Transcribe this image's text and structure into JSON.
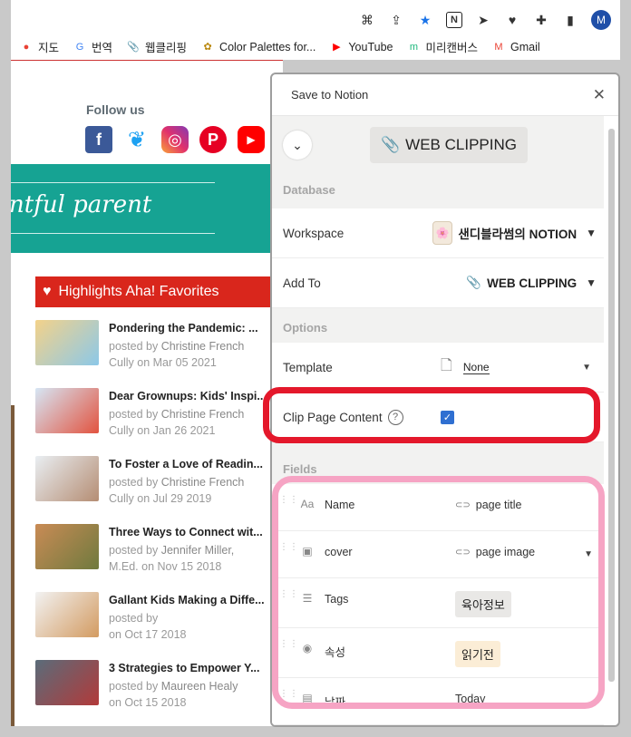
{
  "browser": {
    "bookmarks": [
      {
        "label": "지도",
        "icon": "maps-pin-icon",
        "color": "#e94235"
      },
      {
        "label": "번역",
        "icon": "translate-icon",
        "color": "#4285f4"
      },
      {
        "label": "웹클리핑",
        "icon": "paperclip-icon",
        "color": "#666666"
      },
      {
        "label": "Color Palettes for...",
        "icon": "color-palette-icon",
        "color": "#b8860b"
      },
      {
        "label": "YouTube",
        "icon": "youtube-icon",
        "color": "#ff0000"
      },
      {
        "label": "미리캔버스",
        "icon": "miricanvas-icon",
        "color": "#1db87c"
      },
      {
        "label": "Gmail",
        "icon": "gmail-icon",
        "color": "#ea4335"
      }
    ],
    "profile_initial": "M"
  },
  "site": {
    "follow_us": "Follow us",
    "banner_text": "ntful parent",
    "highlights_title": "Highlights Aha! Favorites",
    "posts": [
      {
        "title": "Pondering the Pandemic: ...",
        "meta_prefix": "posted by ",
        "author": "Christine French",
        "meta_line2": "Cully on Mar 05 2021"
      },
      {
        "title": "Dear Grownups: Kids' Inspi...",
        "meta_prefix": "posted by ",
        "author": "Christine French",
        "meta_line2": "Cully on Jan 26 2021"
      },
      {
        "title": "To Foster a Love of Readin...",
        "meta_prefix": "posted by ",
        "author": "Christine French",
        "meta_line2": "Cully on Jul 29 2019"
      },
      {
        "title": "Three Ways to Connect wit...",
        "meta_prefix": "posted by ",
        "author": "Jennifer Miller,",
        "meta_line2": "M.Ed. on Nov 15 2018"
      },
      {
        "title": "Gallant Kids Making a Diffe...",
        "meta_prefix": "posted by ",
        "author": "",
        "meta_line2": "on Oct 17 2018"
      },
      {
        "title": "3 Strategies to Empower Y...",
        "meta_prefix": "posted by ",
        "author": "Maureen Healy",
        "meta_line2": "on Oct 15 2018"
      }
    ]
  },
  "notion": {
    "header_title": "Save to Notion",
    "page_chip": "WEB CLIPPING",
    "database_label": "Database",
    "workspace_label": "Workspace",
    "workspace_value": "샌디블라썸의 NOTION",
    "addto_label": "Add To",
    "addto_value": "WEB CLIPPING",
    "options_label": "Options",
    "template_label": "Template",
    "template_value": "None",
    "clip_label": "Clip Page Content",
    "clip_checked": true,
    "fields_label": "Fields",
    "fields": [
      {
        "name": "Name",
        "icon": "title-icon",
        "value": "page title",
        "value_icon": "link-icon",
        "kind": "text"
      },
      {
        "name": "cover",
        "icon": "image-icon",
        "value": "page image",
        "value_icon": "link-icon",
        "kind": "select"
      },
      {
        "name": "Tags",
        "icon": "list-icon",
        "value": "육아정보",
        "kind": "tag",
        "tag_color": "#e9e8e6"
      },
      {
        "name": "속성",
        "icon": "status-icon",
        "value": "읽기전",
        "kind": "tag",
        "tag_color": "#fbedd6"
      },
      {
        "name": "날짜",
        "icon": "calendar-icon",
        "value": "Today",
        "kind": "text"
      }
    ]
  }
}
